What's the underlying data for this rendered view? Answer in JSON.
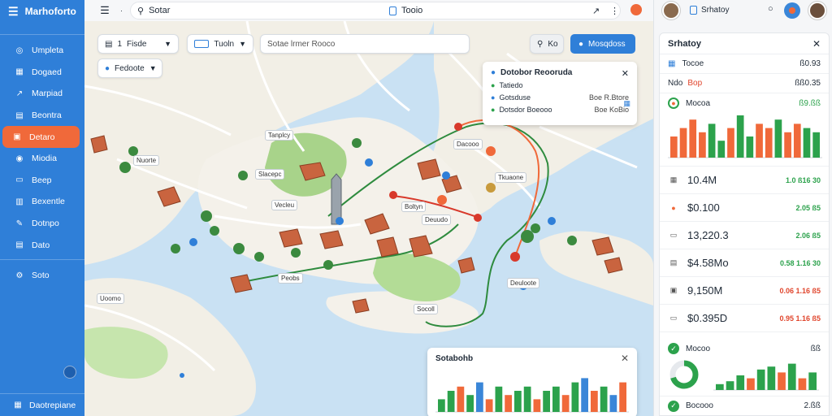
{
  "app": {
    "title": "Marhoforto"
  },
  "sidebar": {
    "items": [
      {
        "label": "Umpleta",
        "icon": "compass-icon"
      },
      {
        "label": "Dogaed",
        "icon": "grid-icon"
      },
      {
        "label": "Marpiad",
        "icon": "route-icon"
      },
      {
        "label": "Beontra",
        "icon": "file-icon"
      },
      {
        "label": "Detaro",
        "icon": "layers-icon",
        "active": true
      },
      {
        "label": "Miodia",
        "icon": "pin-icon"
      },
      {
        "label": "Beep",
        "icon": "chat-icon"
      },
      {
        "label": "Bexentle",
        "icon": "chart-icon"
      },
      {
        "label": "Dotnpo",
        "icon": "pencil-icon"
      },
      {
        "label": "Dato",
        "icon": "table-icon"
      },
      {
        "label": "Soto",
        "icon": "settings-icon"
      }
    ],
    "footer": "Daotrepiane"
  },
  "topbar": {
    "search_label": "Sotar",
    "center_label": "Tooio",
    "right_icon": "N"
  },
  "map": {
    "layer_select": "Fisde",
    "layer_prefix": "1",
    "view_select": "Tuoln",
    "search_placeholder": "Sotae lrmer Rooco",
    "zoom_button": "Ko",
    "primary_button": "Mosqdoss",
    "sub_select": "Fedoote",
    "labels": [
      "Nuorte",
      "Slacepc",
      "Vecleu",
      "Boltyn",
      "Dacooo",
      "Tkuaone",
      "Tanplcy",
      "Deuudo",
      "Deuloote",
      "Peobs",
      "Uoomo",
      "Socoll"
    ]
  },
  "info_card": {
    "title": "Dotobor Reooruda",
    "rows": [
      {
        "label": "Tatiedo",
        "value": ""
      },
      {
        "label": "Gotsduse",
        "value": "Boe R.Btore"
      },
      {
        "label": "Dotsdor Boeooo",
        "value": "Boe KoBio"
      }
    ]
  },
  "chart_card": {
    "title": "Sotabohb"
  },
  "right_panel": {
    "title": "Srhatoy",
    "rows": [
      {
        "label": "Tocoe",
        "value": "ß0.93",
        "tag": ""
      },
      {
        "label": "Ndo",
        "value": "ßß0.35",
        "tag": "Bop"
      }
    ],
    "section1": {
      "label": "Mocoa",
      "value": "ß9.ßß"
    },
    "metrics": [
      {
        "value": "10.4M",
        "change": "1.0 ß16 30",
        "color": "green"
      },
      {
        "value": "$0.100",
        "change": "2.05 ß5",
        "color": "green"
      },
      {
        "value": "13,220.3",
        "change": "2.06 ß5",
        "color": "green"
      },
      {
        "value": "$4.58Mo",
        "change": "0.58 1.16 30",
        "color": "green"
      },
      {
        "value": "9,150M",
        "change": "0.06 1.16 ß5",
        "color": "red"
      },
      {
        "value": "$0.395D",
        "change": "0.95 1.16 ß5",
        "color": "red"
      }
    ],
    "section2": {
      "label": "Mocoo",
      "value": "ßß"
    },
    "footer": {
      "label": "Bocooo",
      "value": "2.ßß"
    }
  },
  "chart_data": [
    {
      "type": "bar",
      "title": "Sotabohb",
      "colors": [
        "#2ca24c",
        "#f0693a",
        "#3a86d8"
      ],
      "values": [
        3,
        5,
        6,
        4,
        7,
        3,
        6,
        4,
        5,
        6,
        3,
        5,
        6,
        4,
        7,
        8,
        5,
        6,
        4,
        7
      ],
      "series_colors": [
        0,
        0,
        1,
        0,
        2,
        1,
        0,
        1,
        0,
        0,
        1,
        0,
        0,
        1,
        0,
        2,
        1,
        0,
        2,
        1
      ],
      "ylim": [
        0,
        10
      ]
    },
    {
      "type": "bar",
      "title": "Mocoa",
      "colors": [
        "#2ca24c",
        "#f0693a"
      ],
      "values": [
        5,
        7,
        9,
        6,
        8,
        4,
        7,
        10,
        5,
        8,
        7,
        9,
        6,
        8,
        7,
        6
      ],
      "series_colors": [
        1,
        1,
        1,
        1,
        0,
        0,
        1,
        0,
        0,
        1,
        1,
        0,
        1,
        1,
        0,
        0
      ],
      "ylim": [
        0,
        10
      ]
    },
    {
      "type": "bar",
      "title": "Mocoo",
      "colors": [
        "#2ca24c",
        "#f0693a"
      ],
      "values": [
        2,
        3,
        5,
        4,
        7,
        8,
        6,
        9,
        4,
        6
      ],
      "series_colors": [
        0,
        0,
        0,
        1,
        0,
        0,
        1,
        0,
        1,
        0
      ],
      "ylim": [
        0,
        10
      ]
    }
  ]
}
